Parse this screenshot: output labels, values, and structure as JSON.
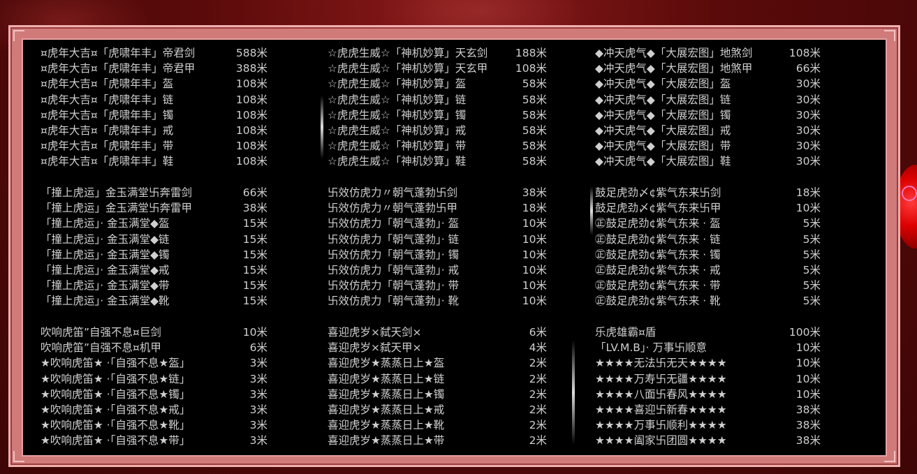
{
  "sections": [
    {
      "rows": [
        {
          "name": "¤虎年大吉¤「虎啸年丰」帝君剑",
          "price": "588米"
        },
        {
          "name": "¤虎年大吉¤「虎啸年丰」帝君甲",
          "price": "388米"
        },
        {
          "name": "¤虎年大吉¤「虎啸年丰」盔",
          "price": "108米"
        },
        {
          "name": "¤虎年大吉¤「虎啸年丰」链",
          "price": "108米"
        },
        {
          "name": "¤虎年大吉¤「虎啸年丰」镯",
          "price": "108米"
        },
        {
          "name": "¤虎年大吉¤「虎啸年丰」戒",
          "price": "108米"
        },
        {
          "name": "¤虎年大吉¤「虎啸年丰」带",
          "price": "108米"
        },
        {
          "name": "¤虎年大吉¤「虎啸年丰」鞋",
          "price": "108米"
        }
      ]
    },
    {
      "rows": [
        {
          "name": "☆虎虎生威☆「神机妙算」天玄剑",
          "price": "188米"
        },
        {
          "name": "☆虎虎生威☆「神机妙算」天玄甲",
          "price": "108米"
        },
        {
          "name": "☆虎虎生威☆「神机妙算」盔",
          "price": "58米"
        },
        {
          "name": "☆虎虎生威☆「神机妙算」链",
          "price": "58米"
        },
        {
          "name": "☆虎虎生威☆「神机妙算」镯",
          "price": "58米"
        },
        {
          "name": "☆虎虎生威☆「神机妙算」戒",
          "price": "58米"
        },
        {
          "name": "☆虎虎生威☆「神机妙算」带",
          "price": "58米"
        },
        {
          "name": "☆虎虎生威☆「神机妙算」鞋",
          "price": "58米"
        }
      ]
    },
    {
      "rows": [
        {
          "name": "◆冲天虎气◆「大展宏图」地煞剑",
          "price": "108米"
        },
        {
          "name": "◆冲天虎气◆「大展宏图」地煞甲",
          "price": "66米"
        },
        {
          "name": "◆冲天虎气◆「大展宏图」盔",
          "price": "30米"
        },
        {
          "name": "◆冲天虎气◆「大展宏图」链",
          "price": "30米"
        },
        {
          "name": "◆冲天虎气◆「大展宏图」镯",
          "price": "30米"
        },
        {
          "name": "◆冲天虎气◆「大展宏图」戒",
          "price": "30米"
        },
        {
          "name": "◆冲天虎气◆「大展宏图」带",
          "price": "30米"
        },
        {
          "name": "◆冲天虎气◆「大展宏图」鞋",
          "price": "30米"
        }
      ]
    },
    {
      "rows": [
        {
          "name": "「撞上虎运」金玉满堂卐奔雷剑",
          "price": "66米"
        },
        {
          "name": "「撞上虎运」金玉满堂卐奔雷甲",
          "price": "38米"
        },
        {
          "name": "「撞上虎运」· 金玉满堂◆盔",
          "price": "15米"
        },
        {
          "name": "「撞上虎运」· 金玉满堂◆链",
          "price": "15米"
        },
        {
          "name": "「撞上虎运」· 金玉满堂◆镯",
          "price": "15米"
        },
        {
          "name": "「撞上虎运」· 金玉满堂◆戒",
          "price": "15米"
        },
        {
          "name": "「撞上虎运」· 金玉满堂◆带",
          "price": "15米"
        },
        {
          "name": "「撞上虎运」· 金玉满堂◆靴",
          "price": "15米"
        }
      ]
    },
    {
      "rows": [
        {
          "name": "卐效仿虎力〃朝气蓬勃卐剑",
          "price": "38米"
        },
        {
          "name": "卐效仿虎力〃朝气蓬勃卐甲",
          "price": "18米"
        },
        {
          "name": "卐效仿虎力「朝气蓬勃」· 盔",
          "price": "10米"
        },
        {
          "name": "卐效仿虎力「朝气蓬勃」· 链",
          "price": "10米"
        },
        {
          "name": "卐效仿虎力「朝气蓬勃」· 镯",
          "price": "10米"
        },
        {
          "name": "卐效仿虎力「朝气蓬勃」· 戒",
          "price": "10米"
        },
        {
          "name": "卐效仿虎力「朝气蓬勃」· 带",
          "price": "10米"
        },
        {
          "name": "卐效仿虎力「朝气蓬勃」· 靴",
          "price": "10米"
        }
      ]
    },
    {
      "rows": [
        {
          "name": "鼓足虎劲〆¢紫气东来卐剑",
          "price": "18米"
        },
        {
          "name": "鼓足虎劲〆¢紫气东来卐甲",
          "price": "10米"
        },
        {
          "name": "㊣鼓足虎劲¢紫气东来 · 盔",
          "price": "5米"
        },
        {
          "name": "㊣鼓足虎劲¢紫气东来 · 链",
          "price": "5米"
        },
        {
          "name": "㊣鼓足虎劲¢紫气东来 · 镯",
          "price": "5米"
        },
        {
          "name": "㊣鼓足虎劲¢紫气东来 · 戒",
          "price": "5米"
        },
        {
          "name": "㊣鼓足虎劲¢紫气东来 · 带",
          "price": "5米"
        },
        {
          "name": "㊣鼓足虎劲¢紫气东来 · 靴",
          "price": "5米"
        }
      ]
    },
    {
      "rows": [
        {
          "name": "吹响虎笛”自强不息¤巨剑",
          "price": "10米"
        },
        {
          "name": "吹响虎笛”自强不息¤机甲",
          "price": "6米"
        },
        {
          "name": "★吹响虎笛★ ·「自强不息★盔」",
          "price": "3米"
        },
        {
          "name": "★吹响虎笛★ ·「自强不息★链」",
          "price": "3米"
        },
        {
          "name": "★吹响虎笛★ ·「自强不息★镯」",
          "price": "3米"
        },
        {
          "name": "★吹响虎笛★ ·「自强不息★戒」",
          "price": "3米"
        },
        {
          "name": "★吹响虎笛★ ·「自强不息★靴」",
          "price": "3米"
        },
        {
          "name": "★吹响虎笛★ ·「自强不息★带」",
          "price": "3米"
        }
      ]
    },
    {
      "rows": [
        {
          "name": "喜迎虎岁×弑天剑×",
          "price": "6米"
        },
        {
          "name": "喜迎虎岁×弑天甲×",
          "price": "4米"
        },
        {
          "name": "喜迎虎岁★蒸蒸日上★盔",
          "price": "2米"
        },
        {
          "name": "喜迎虎岁★蒸蒸日上★链",
          "price": "2米"
        },
        {
          "name": "喜迎虎岁★蒸蒸日上★镯",
          "price": "2米"
        },
        {
          "name": "喜迎虎岁★蒸蒸日上★戒",
          "price": "2米"
        },
        {
          "name": "喜迎虎岁★蒸蒸日上★靴",
          "price": "2米"
        },
        {
          "name": "喜迎虎岁★蒸蒸日上★带",
          "price": "2米"
        }
      ]
    },
    {
      "rows": [
        {
          "name": "乐虎雄霸¤盾",
          "price": "100米"
        },
        {
          "name": "「LV.M.B」· 万事卐顺意",
          "price": "10米"
        },
        {
          "name": "★★★★无法卐无天★★★★",
          "price": "10米"
        },
        {
          "name": "★★★★万寿卐无疆★★★★",
          "price": "10米"
        },
        {
          "name": "★★★★八面卐春风★★★★",
          "price": "10米"
        },
        {
          "name": "★★★★喜迎卐新春★★★★",
          "price": "38米"
        },
        {
          "name": "★★★★万事卐顺利★★★★",
          "price": "38米"
        },
        {
          "name": "★★★★阖家卐团圆★★★★",
          "price": "38米"
        }
      ]
    }
  ]
}
